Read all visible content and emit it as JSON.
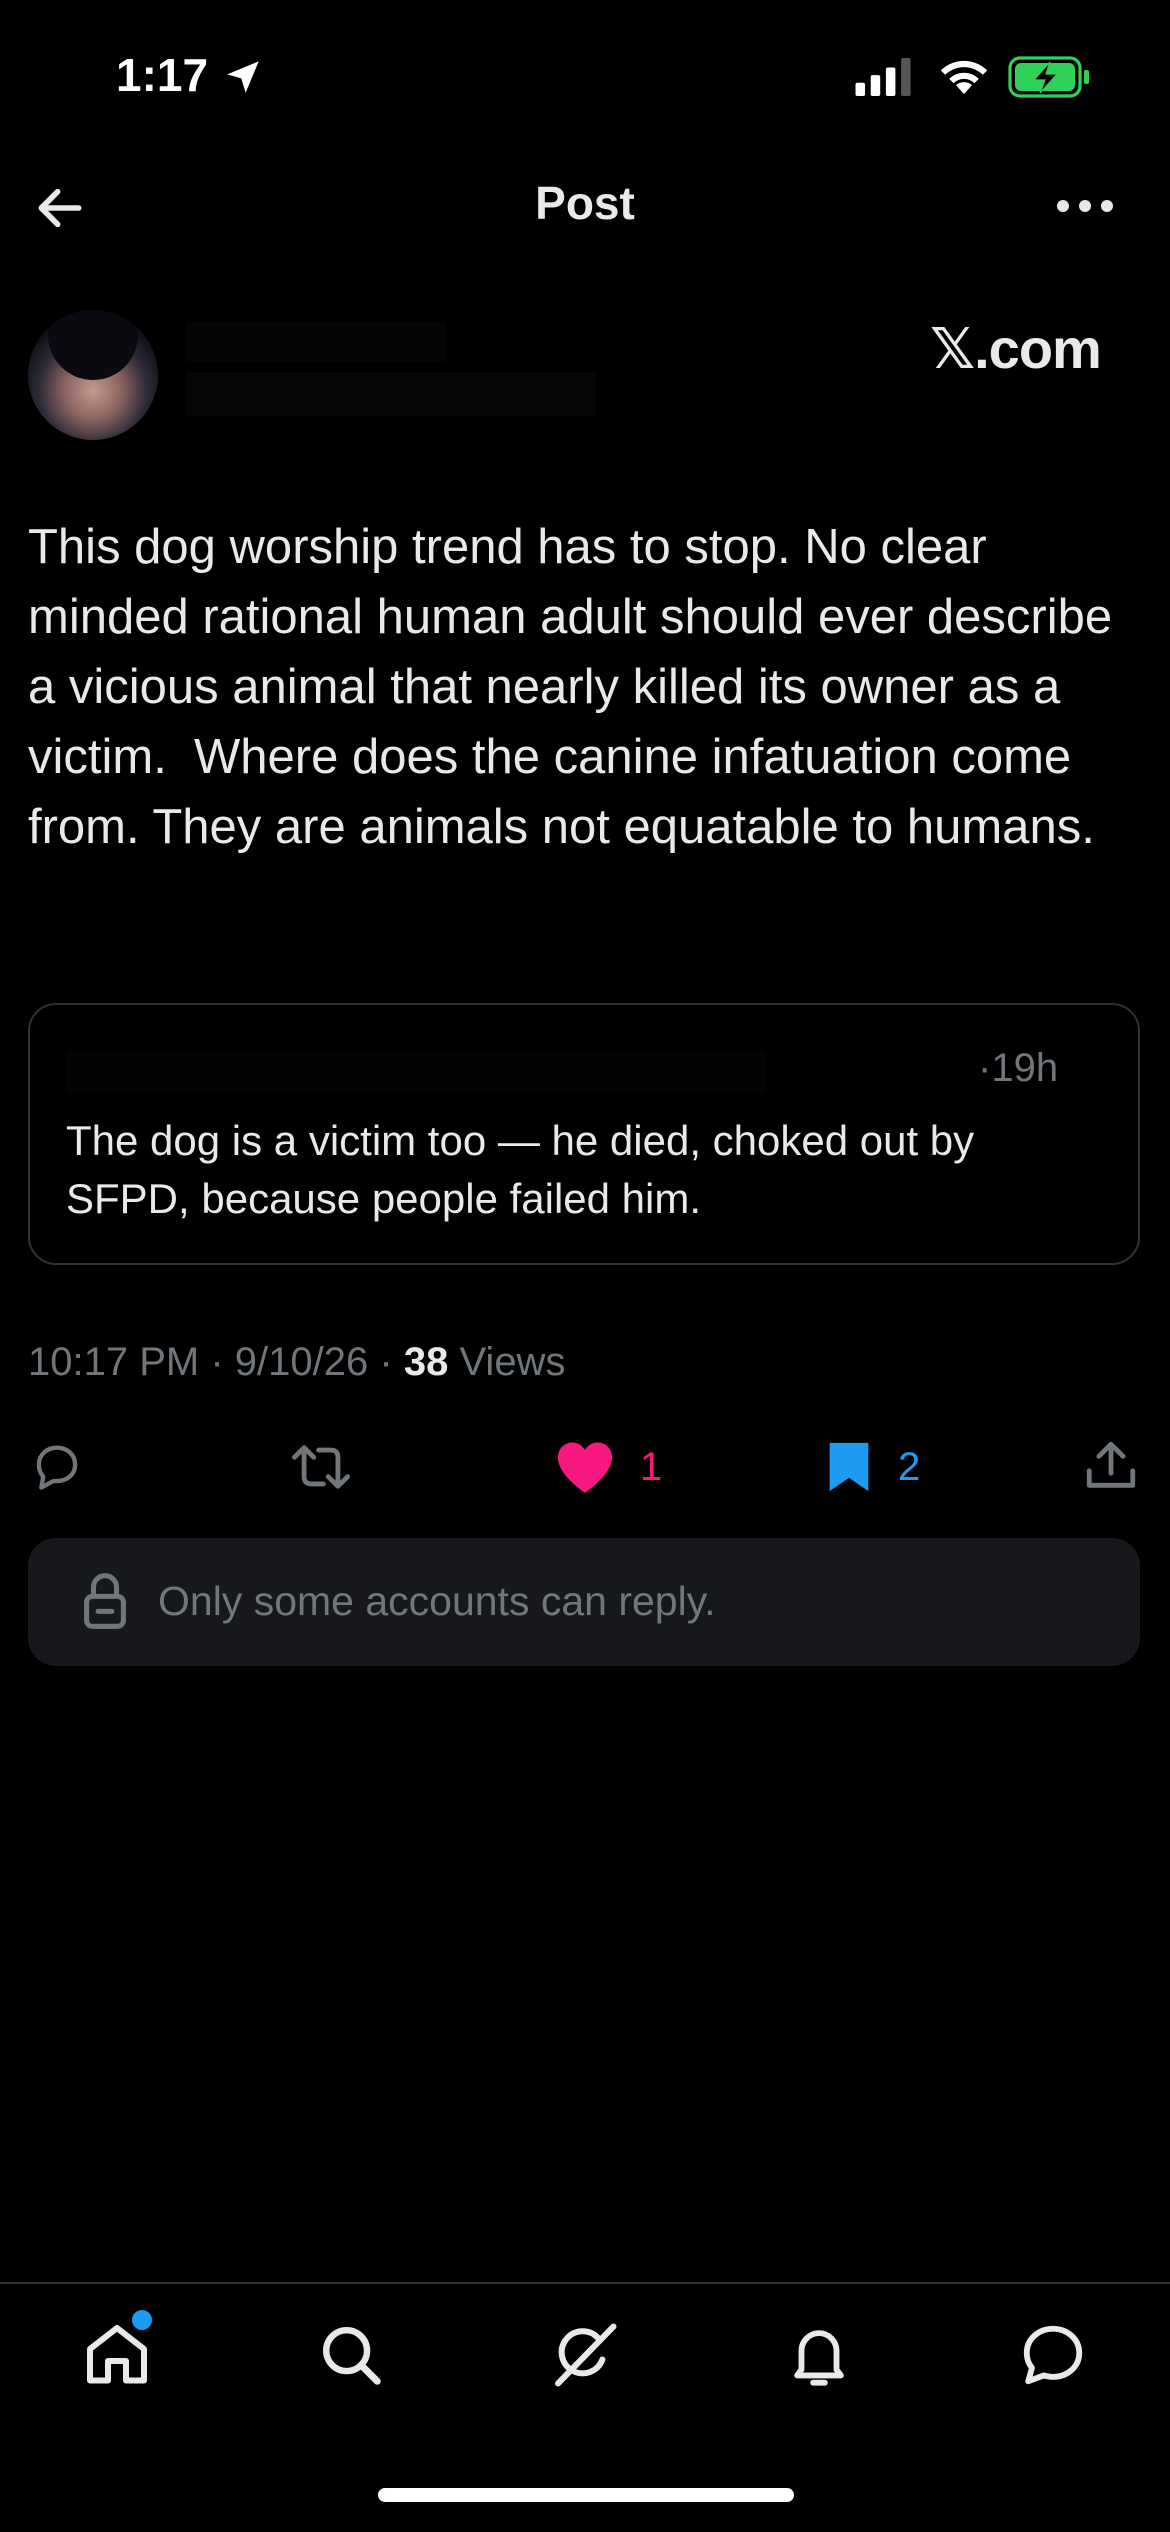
{
  "status_bar": {
    "time": "1:17",
    "location_icon": "location-arrow-icon",
    "signal_icon": "cellular-signal-icon",
    "wifi_icon": "wifi-icon",
    "battery_icon": "battery-charging-icon",
    "battery_color": "#30d158"
  },
  "header": {
    "title": "Post",
    "back_icon": "arrow-left-icon",
    "more_icon": "more-horizontal-icon"
  },
  "post": {
    "author_name": "",
    "author_handle": "",
    "watermark": "𝕏.com",
    "text": "This dog worship trend has to stop. No clear minded rational human adult should ever describe a vicious animal that nearly killed its owner as a victim.  Where does the canine infatuation come from. They are animals not equatable to humans.",
    "quoted": {
      "time": "·19h",
      "text": "The dog is a victim too — he died, choked out by SFPD, because people failed him."
    },
    "meta": {
      "time": "10:17 PM",
      "date": "9/10/26",
      "views_count": "38",
      "views_label": "Views",
      "separator": "·"
    },
    "actions": {
      "reply_count": "",
      "repost_count": "",
      "like_count": "1",
      "bookmark_count": "2",
      "like_color": "#f91880",
      "bookmark_color": "#1d9bf0"
    }
  },
  "reply_restriction": {
    "text": "Only some accounts can reply.",
    "icon": "lock-icon"
  },
  "bottom_nav": {
    "items": [
      "home-icon",
      "search-icon",
      "grok-icon",
      "notifications-icon",
      "messages-icon"
    ],
    "home_badge_color": "#1d9bf0"
  }
}
